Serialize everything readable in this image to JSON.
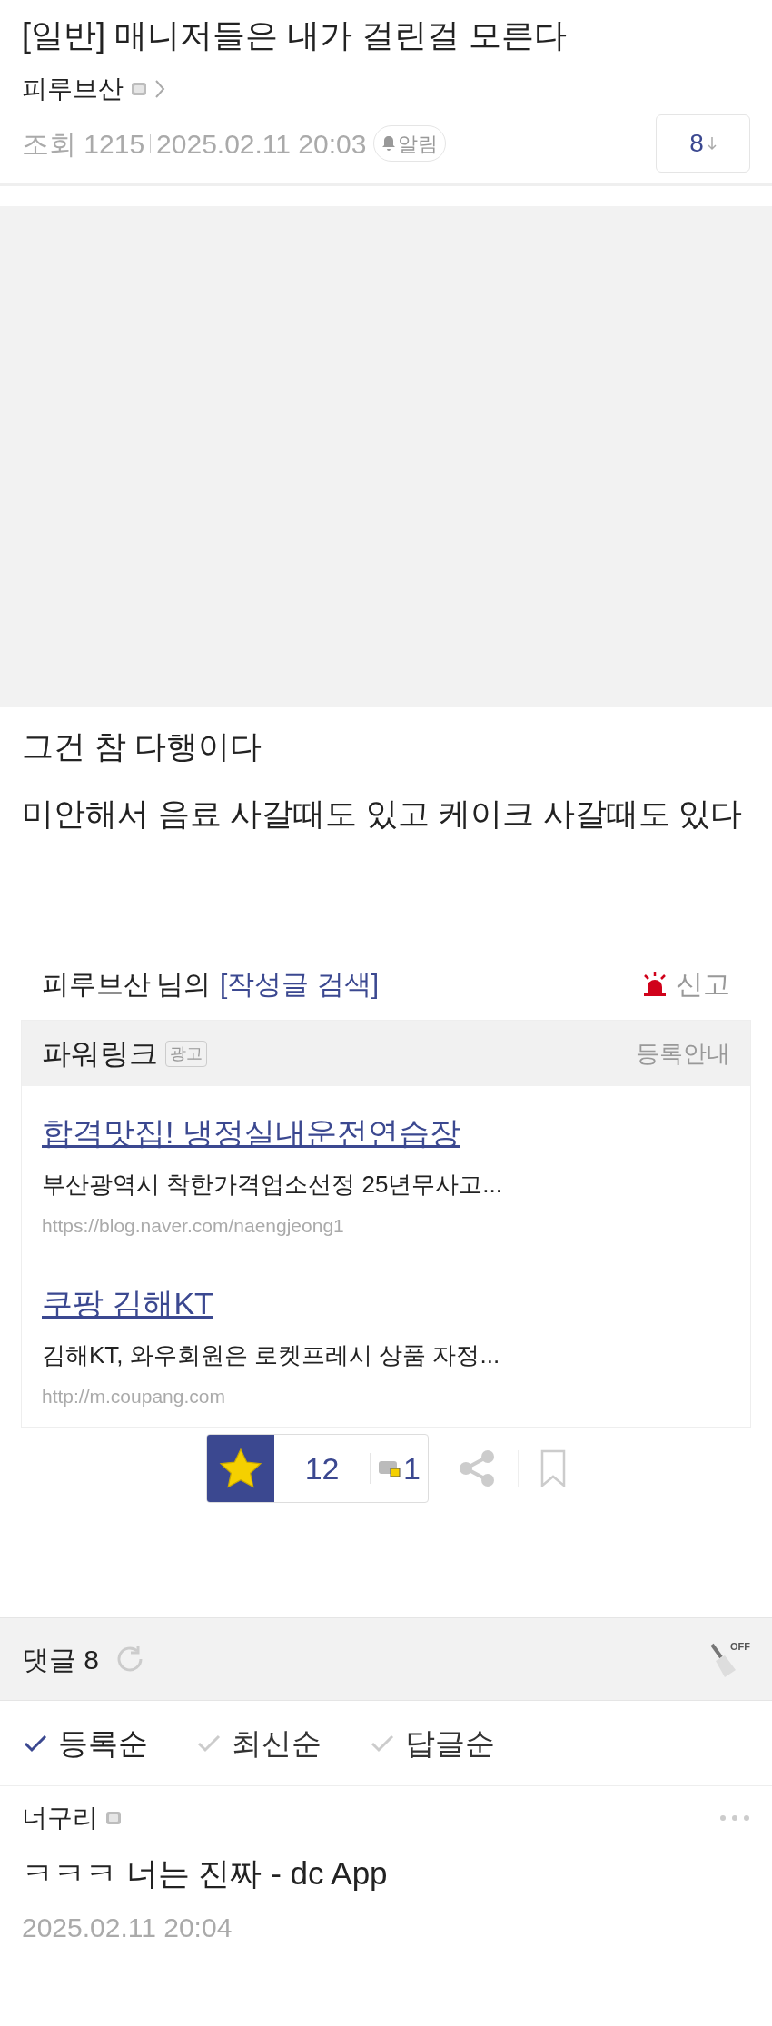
{
  "post": {
    "title": "[일반] 매니저들은 내가 걸린걸 모른다",
    "author": "피루브산",
    "views_label": "조회",
    "views": "1215",
    "date": "2025.02.11 20:03",
    "alarm": "알림",
    "comment_jump": "8"
  },
  "body": {
    "paragraphs": [
      "그건 참 다행이다",
      "미안해서 음료 사갈때도 있고 케이크 사갈때도 있다"
    ]
  },
  "author_search": {
    "author": "피루브산",
    "suffix": "님의",
    "link": "[작성글 검색]",
    "report": "신고"
  },
  "powerlink": {
    "title": "파워링크",
    "badge": "광고",
    "register": "등록안내",
    "ads": [
      {
        "title": "합격맛집! 냉정실내운전연습장",
        "description": "부산광역시 착한가격업소선정 25년무사고...",
        "url": "https://blog.naver.com/naengjeong1"
      },
      {
        "title": "쿠팡 김해KT",
        "description": "김해KT, 와우회원은 로켓프레시 상품 자정...",
        "url": "http://m.coupang.com"
      }
    ]
  },
  "votes": {
    "up": "12",
    "fixed": "1"
  },
  "comments": {
    "label": "댓글",
    "count": "8",
    "filter_label": "OFF",
    "sort": [
      {
        "label": "등록순",
        "selected": true
      },
      {
        "label": "최신순",
        "selected": false
      },
      {
        "label": "답글순",
        "selected": false
      }
    ],
    "items": [
      {
        "author": "너구리",
        "text": "ㅋㅋㅋ 너는 진짜 - dc App",
        "date": "2025.02.11 20:04"
      }
    ]
  }
}
